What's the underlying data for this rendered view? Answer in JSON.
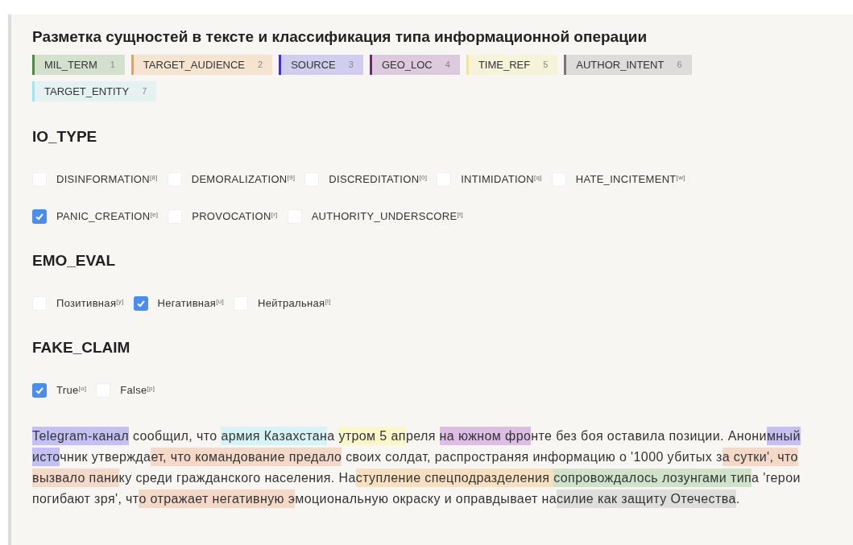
{
  "title": "Разметка сущностей в тексте и классификация типа информационной операции",
  "labels": [
    {
      "name": "MIL_TERM",
      "hotkey": "1",
      "color": "#4c8a3e"
    },
    {
      "name": "TARGET_AUDIENCE",
      "hotkey": "2",
      "color": "#f0a040"
    },
    {
      "name": "SOURCE",
      "hotkey": "3",
      "color": "#3a2ee0"
    },
    {
      "name": "GEO_LOC",
      "hotkey": "4",
      "color": "#7a1f80"
    },
    {
      "name": "TIME_REF",
      "hotkey": "5",
      "color": "#f2ec70"
    },
    {
      "name": "AUTHOR_INTENT",
      "hotkey": "6",
      "color": "#777777"
    },
    {
      "name": "TARGET_ENTITY",
      "hotkey": "7",
      "color": "#9ee6ef"
    }
  ],
  "sections": [
    {
      "heading": "IO_TYPE",
      "choices": [
        {
          "label": "DISINFORMATION",
          "hotkey": "[8]",
          "checked": false
        },
        {
          "label": "DEMORALIZATION",
          "hotkey": "[9]",
          "checked": false
        },
        {
          "label": "DISCREDITATION",
          "hotkey": "[0]",
          "checked": false
        },
        {
          "label": "INTIMIDATION",
          "hotkey": "[q]",
          "checked": false
        },
        {
          "label": "HATE_INCITEMENT",
          "hotkey": "[w]",
          "checked": false
        },
        {
          "label": "PANIC_CREATION",
          "hotkey": "[e]",
          "checked": true
        },
        {
          "label": "PROVOCATION",
          "hotkey": "[r]",
          "checked": false
        },
        {
          "label": "AUTHORITY_UNDERSCORE",
          "hotkey": "[t]",
          "checked": false
        }
      ]
    },
    {
      "heading": "EMO_EVAL",
      "choices": [
        {
          "label": "Позитивная",
          "hotkey": "[y]",
          "checked": false
        },
        {
          "label": "Негативная",
          "hotkey": "[u]",
          "checked": true
        },
        {
          "label": "Нейтральная",
          "hotkey": "[i]",
          "checked": false
        }
      ]
    },
    {
      "heading": "FAKE_CLAIM",
      "choices": [
        {
          "label": "True",
          "hotkey": "[o]",
          "checked": true
        },
        {
          "label": "False",
          "hotkey": "[p]",
          "checked": false
        }
      ]
    }
  ],
  "text_segments": [
    {
      "text": "Telegram-канал",
      "color": "#c5c0f4"
    },
    {
      "text": " сообщил, что "
    },
    {
      "text": "армия Казахстан",
      "color": "#d6f3f5"
    },
    {
      "text": "а "
    },
    {
      "text": "утром 5 ап",
      "color": "#fbf7c8"
    },
    {
      "text": "реля "
    },
    {
      "text": "на южном фро",
      "color": "#dcbde3"
    },
    {
      "text": "нте без боя оставила позиции. Анони"
    },
    {
      "text": "мный исто",
      "color": "#c5c0f4"
    },
    {
      "text": "чник утвержда"
    },
    {
      "text": "ет, что командование предало",
      "color": "#f5d9c8"
    },
    {
      "text": " своих солдат, распространяя информацию о '1000 убитых з"
    },
    {
      "text": "а сутки', что вызвало пани",
      "color": "#f5d9c8"
    },
    {
      "text": "ку среди гражданского населения. На"
    },
    {
      "text": "ступление спецподразделения ",
      "color": "#f7e0bf"
    },
    {
      "text": "сопровождалось лозунгами тип",
      "color": "#cfe3ca"
    },
    {
      "text": "а 'герои погибают зря', чт"
    },
    {
      "text": "о отражает негативную э",
      "color": "#f5d9c8"
    },
    {
      "text": "моциональную окраску и оправдывает на"
    },
    {
      "text": "силие как защиту Отечества",
      "color": "#dededc"
    },
    {
      "text": "."
    }
  ]
}
